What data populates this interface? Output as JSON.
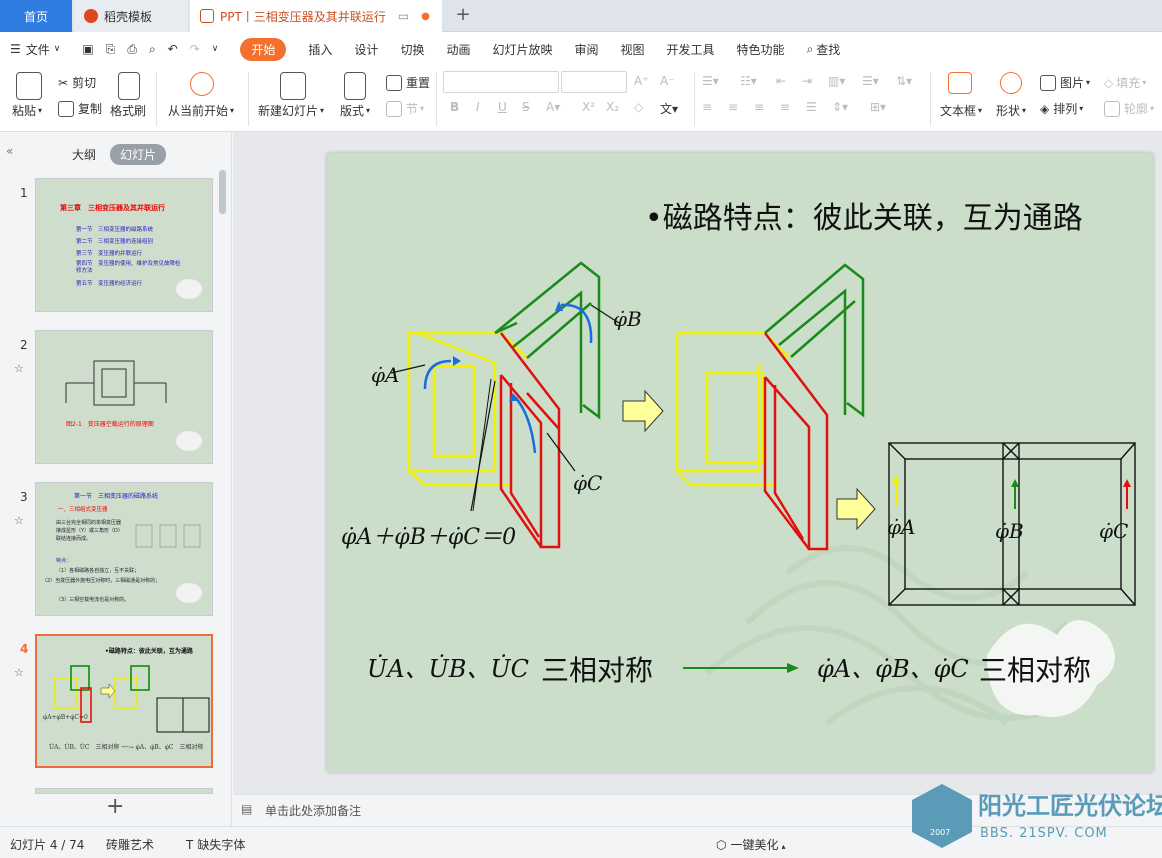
{
  "tabs": {
    "home": "首页",
    "doc": "稻壳模板",
    "active": "PPT丨三相变压器及其并联运行"
  },
  "menu": {
    "file": "文件",
    "items": [
      "开始",
      "插入",
      "设计",
      "切换",
      "动画",
      "幻灯片放映",
      "审阅",
      "视图",
      "开发工具",
      "特色功能"
    ],
    "search": "查找"
  },
  "toolbar": {
    "paste": "粘贴",
    "cut": "剪切",
    "copy": "复制",
    "format_painter": "格式刷",
    "from_start": "从当前开始",
    "new_slide": "新建幻灯片",
    "layout": "版式",
    "section": "节",
    "reset": "重置",
    "text_box": "文本框",
    "shape": "形状",
    "picture": "图片",
    "arrange": "排列",
    "fill": "填充",
    "outline": "轮廓"
  },
  "sidebar": {
    "tab_outline": "大纲",
    "tab_slides": "幻灯片",
    "thumb1": {
      "num": "1",
      "title": "第三章　三相变压器及其并联运行",
      "lines": [
        "第一节　三相变压器的磁路系统",
        "第二节　三相变压器的连接组别",
        "第三节　变压器的并联运行",
        "第四节　变压器的使用、维护及常见故障检修方法",
        "第五节　变压器的经济运行"
      ]
    },
    "thumb2": {
      "num": "2",
      "caption": "图2-1　变压器空载运行的原理图"
    },
    "thumb3": {
      "num": "3",
      "title": "第一节　三相变压器的磁路系统",
      "sub": "一、三相组式变压器",
      "body": "由三台完全相同的单相变压器接成星形（Y）或三角形（D）联结连接而成。",
      "feat": "特点：",
      "items": [
        "（1）各相磁路各自独立，互不关联；",
        "（2）当变压器外施电压对称时，三相磁通是对称的；",
        "（3）三相空载电流也是对称的。"
      ]
    },
    "thumb4": {
      "num": "4",
      "title": "•磁路特点：彼此关联，互为通路"
    }
  },
  "slide": {
    "title": "•磁路特点：彼此关联，互为通路",
    "phiA": "φ̇A",
    "phiB": "φ̇B",
    "phiC": "φ̇C",
    "equation": "φ̇A＋φ̇B＋φ̇C＝0",
    "voltages": "U̇A、U̇B、U̇C",
    "sym1": "三相对称",
    "fluxes": "φ̇A、φ̇B、φ̇C",
    "sym2": "三相对称",
    "watermark": "阳光工匠光伏论坛"
  },
  "notes": "单击此处添加备注",
  "status": {
    "slide_count": "幻灯片 4 / 74",
    "theme": "砖雕艺术",
    "missing_font": "缺失字体",
    "beautify": "一键美化"
  },
  "brand": {
    "name": "阳光工匠光伏论坛",
    "url": "BBS. 21SPV. COM",
    "year": "2007"
  },
  "colors": {
    "accent": "#f4702e",
    "tab_home": "#2f7de1"
  }
}
